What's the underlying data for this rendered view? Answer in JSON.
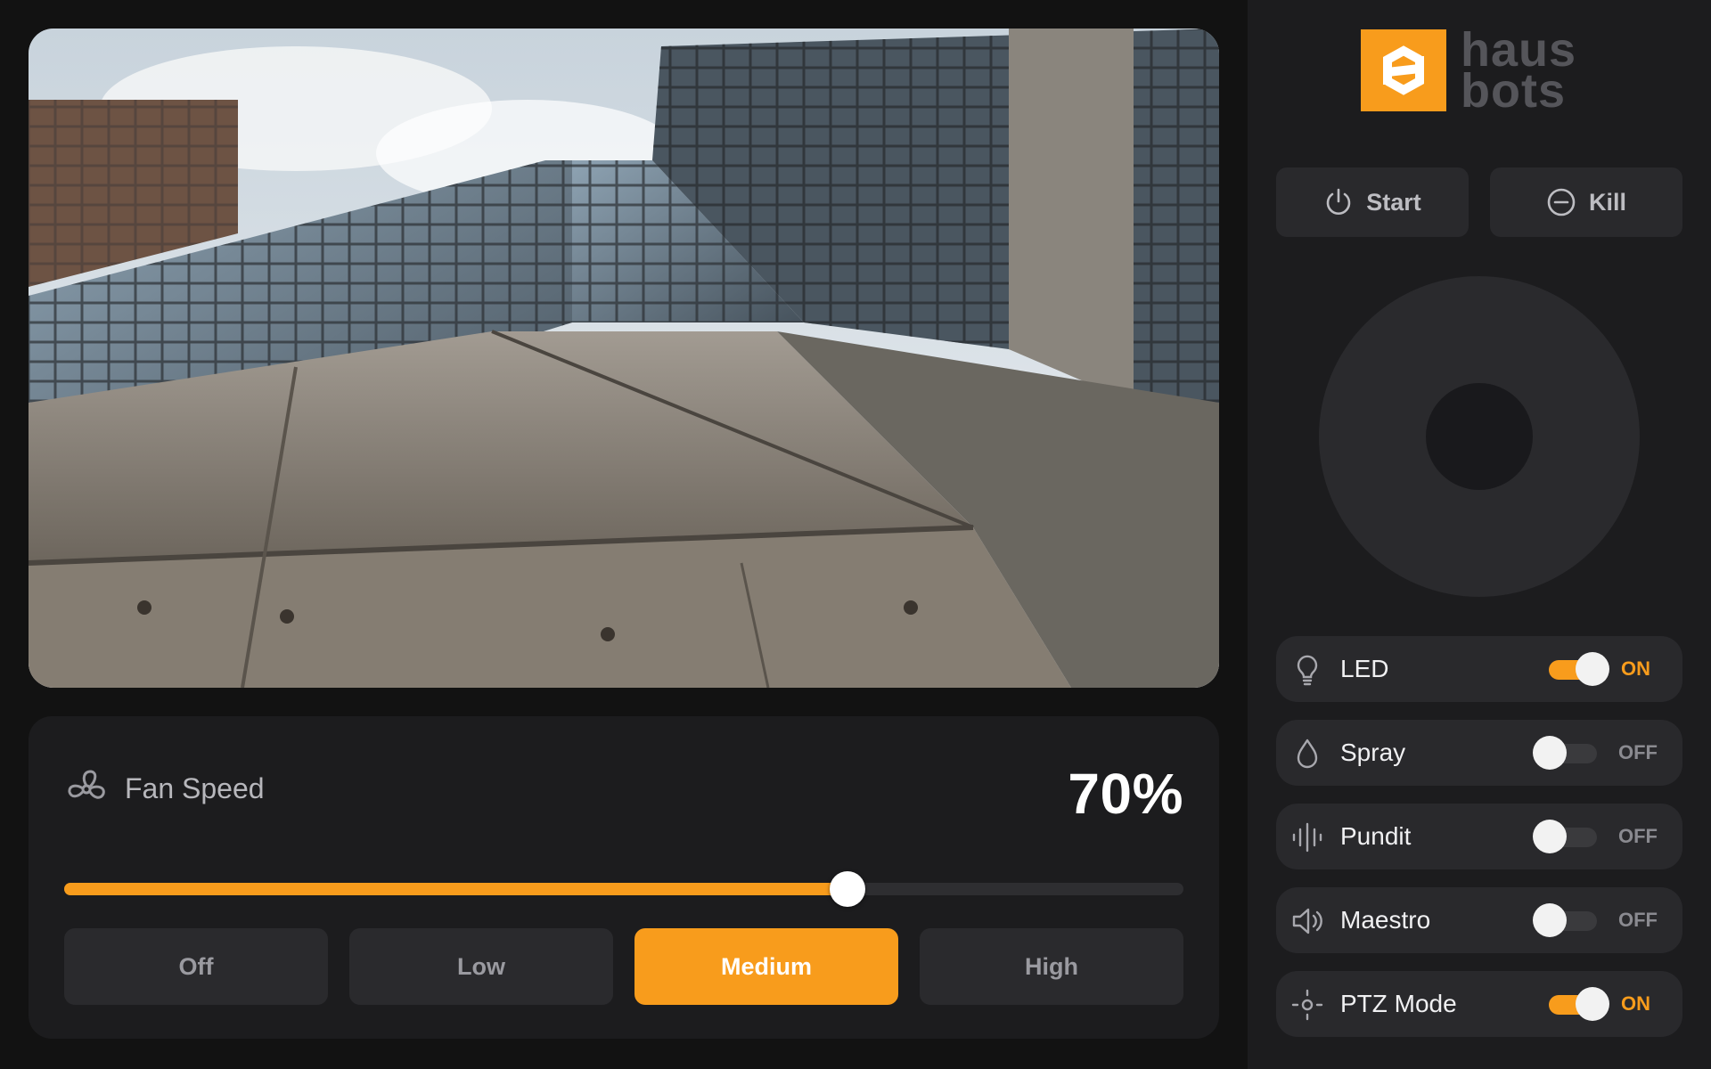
{
  "camera": {
    "description_icon": "camera-feed"
  },
  "fan": {
    "title": "Fan Speed",
    "icon": "fan-icon",
    "value_label": "70%",
    "value_percent": 70,
    "options": [
      {
        "label": "Off",
        "active": false
      },
      {
        "label": "Low",
        "active": false
      },
      {
        "label": "Medium",
        "active": true
      },
      {
        "label": "High",
        "active": false
      }
    ]
  },
  "brand": {
    "line1": "haus",
    "line2": "bots",
    "accent": "#f89c1c"
  },
  "controls": {
    "start_label": "Start",
    "kill_label": "Kill"
  },
  "toggles": [
    {
      "label": "LED",
      "state": "ON",
      "on": true,
      "icon": "bulb-icon"
    },
    {
      "label": "Spray",
      "state": "OFF",
      "on": false,
      "icon": "droplet-icon"
    },
    {
      "label": "Pundit",
      "state": "OFF",
      "on": false,
      "icon": "audio-wave-icon"
    },
    {
      "label": "Maestro",
      "state": "OFF",
      "on": false,
      "icon": "speaker-icon"
    },
    {
      "label": "PTZ Mode",
      "state": "ON",
      "on": true,
      "icon": "ptz-icon"
    }
  ]
}
